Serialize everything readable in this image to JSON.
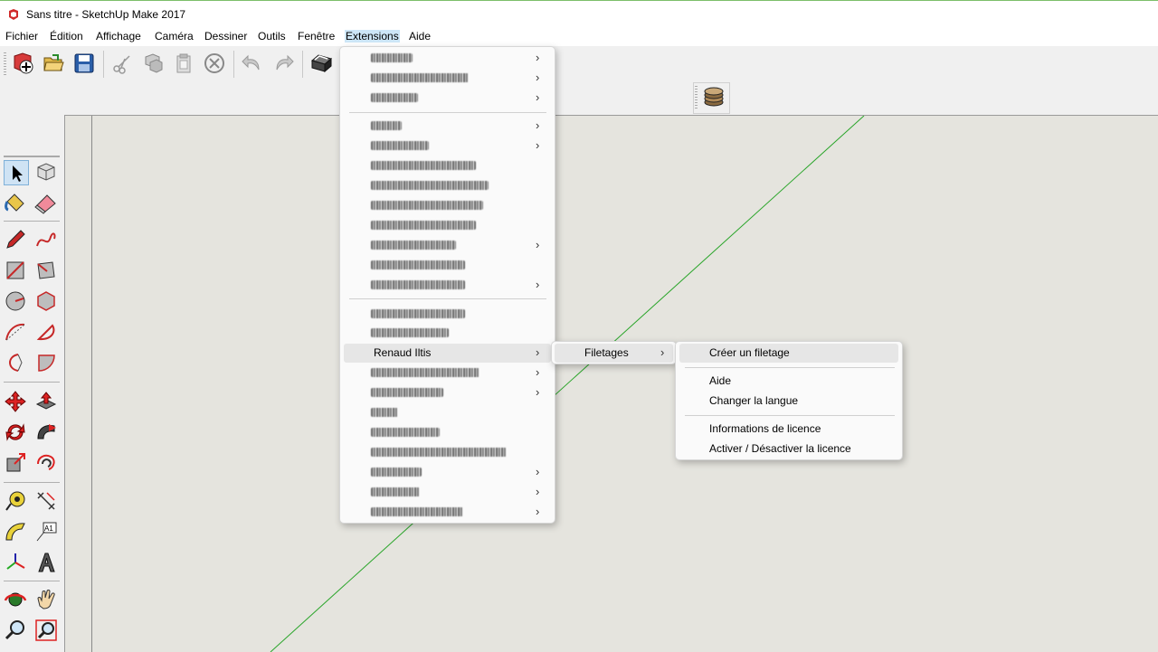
{
  "window": {
    "title": "Sans titre - SketchUp Make 2017"
  },
  "menubar": {
    "items": [
      "Fichier",
      "Édition",
      "Affichage",
      "Caméra",
      "Dessiner",
      "Outils",
      "Fenêtre",
      "Extensions",
      "Aide"
    ],
    "active": "Extensions"
  },
  "toolbar": {
    "icons": [
      "new-icon",
      "open-icon",
      "save-icon",
      "cut-icon",
      "copy-icon",
      "paste-icon",
      "erase-icon",
      "undo-icon",
      "redo-icon",
      "print-icon"
    ]
  },
  "floating_toolbar": {
    "icons": [
      "layers-icon"
    ]
  },
  "tools": [
    "select-icon",
    "component-icon",
    "paint-bucket-icon",
    "eraser-icon",
    "pencil-icon",
    "freehand-icon",
    "rectangle-icon",
    "rotated-rectangle-icon",
    "circle-icon",
    "polygon-icon",
    "arc-icon",
    "pie-icon",
    "arc-3pt-icon",
    "pie-2-icon",
    "move-icon",
    "push-pull-icon",
    "rotate-icon",
    "follow-me-icon",
    "scale-icon",
    "offset-icon",
    "tape-measure-icon",
    "dimension-icon",
    "protractor-icon",
    "text-icon",
    "axes-icon",
    "3d-text-icon",
    "orbit-icon",
    "pan-icon",
    "zoom-icon",
    "zoom-window-icon"
  ],
  "extensions_menu": {
    "highlighted": "Renaud Iltis",
    "submenu": {
      "label": "Filetages",
      "items": [
        "Créer un filetage",
        "Aide",
        "Changer la langue",
        "Informations de licence",
        "Activer / Désactiver la licence"
      ]
    }
  },
  "colors": {
    "accent": "#cc2222",
    "viewport": "#e5e4de",
    "axis_green": "#2aa52a"
  }
}
